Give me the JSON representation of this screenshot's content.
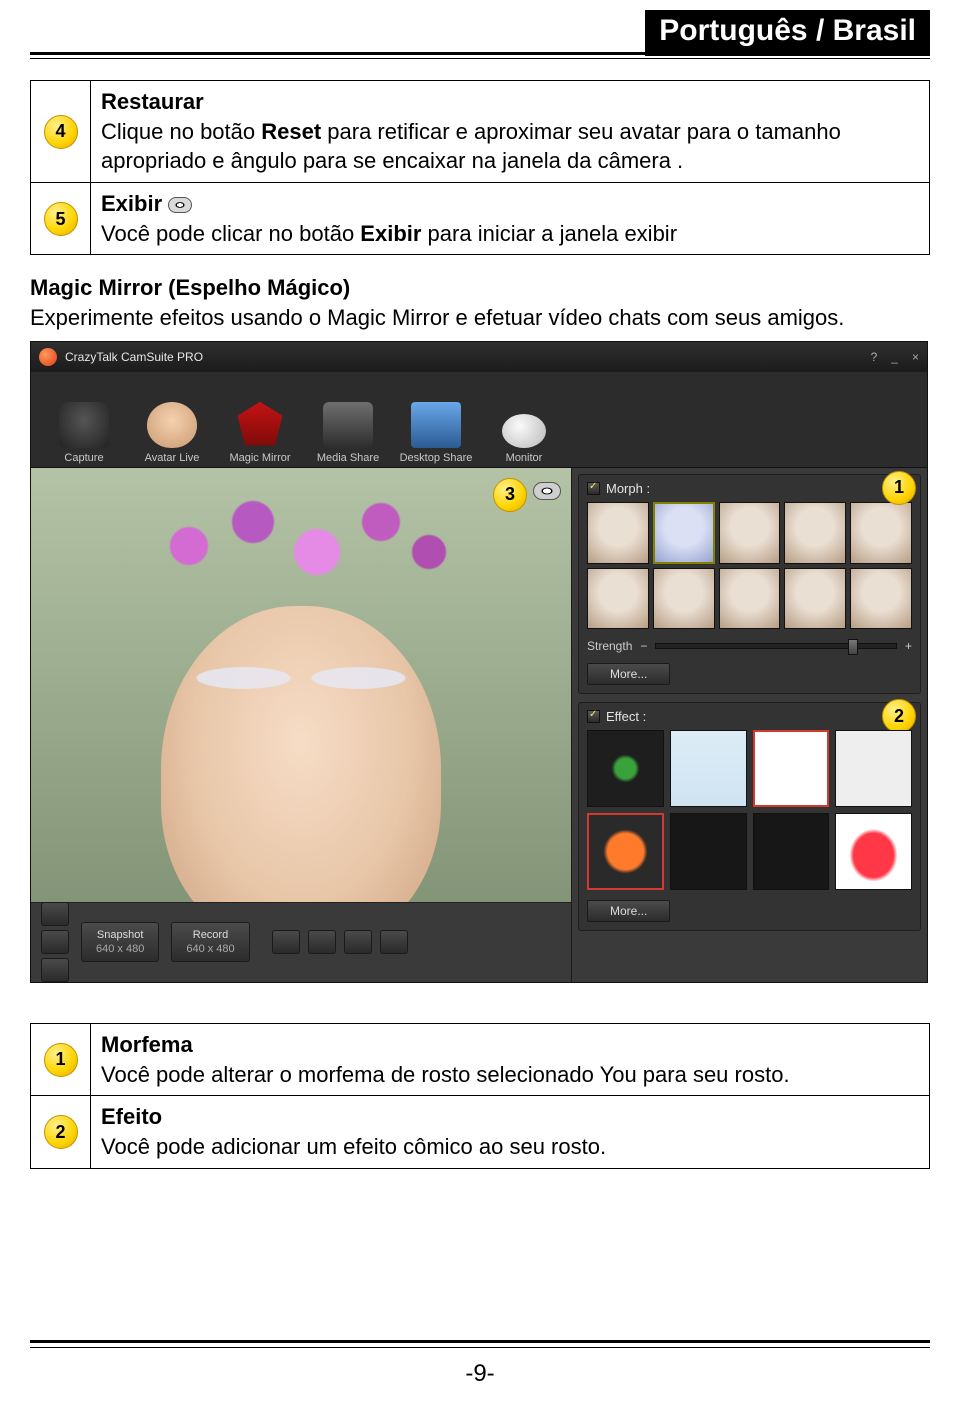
{
  "header": {
    "language": "Português / Brasil"
  },
  "table_top": [
    {
      "num": "4",
      "title": "Restaurar",
      "body_parts": [
        "Clique no botão ",
        {
          "bold": "Reset"
        },
        " para retificar e aproximar seu avatar para o tamanho apropriado e ângulo para se encaixar na janela da câmera ."
      ]
    },
    {
      "num": "5",
      "title": "Exibir",
      "has_eye_icon": true,
      "body_parts": [
        "Você pode clicar no botão ",
        {
          "bold": "Exibir"
        },
        " para iniciar a janela exibir"
      ]
    }
  ],
  "section": {
    "title_bold": "Magic Mirror (Espelho Mágico)",
    "desc": "Experimente efeitos usando o Magic Mirror e efetuar vídeo chats com seus amigos."
  },
  "app": {
    "title": "CrazyTalk CamSuite PRO",
    "win": {
      "help": "?",
      "min": "_",
      "close": "×"
    },
    "toolbar": [
      {
        "label": "Capture",
        "icon": "cam"
      },
      {
        "label": "Avatar Live",
        "icon": "face"
      },
      {
        "label": "Magic Mirror",
        "icon": "mask"
      },
      {
        "label": "Media Share",
        "icon": "media"
      },
      {
        "label": "Desktop Share",
        "icon": "desk"
      },
      {
        "label": "Monitor",
        "icon": "mon"
      }
    ],
    "badges": {
      "b1": "1",
      "b2": "2",
      "b3": "3"
    },
    "morph": {
      "label": "Morph :",
      "strength_label": "Strength",
      "more": "More..."
    },
    "effect": {
      "label": "Effect :",
      "more": "More..."
    },
    "bottom": {
      "snapshot": "Snapshot",
      "record": "Record",
      "res": "640 x 480"
    }
  },
  "table_bottom": [
    {
      "num": "1",
      "title": "Morfema",
      "body": "Você pode alterar o morfema de rosto selecionado You para seu rosto."
    },
    {
      "num": "2",
      "title": "Efeito",
      "body": "Você pode adicionar um efeito cômico ao seu rosto."
    }
  ],
  "page_number": "-9-"
}
